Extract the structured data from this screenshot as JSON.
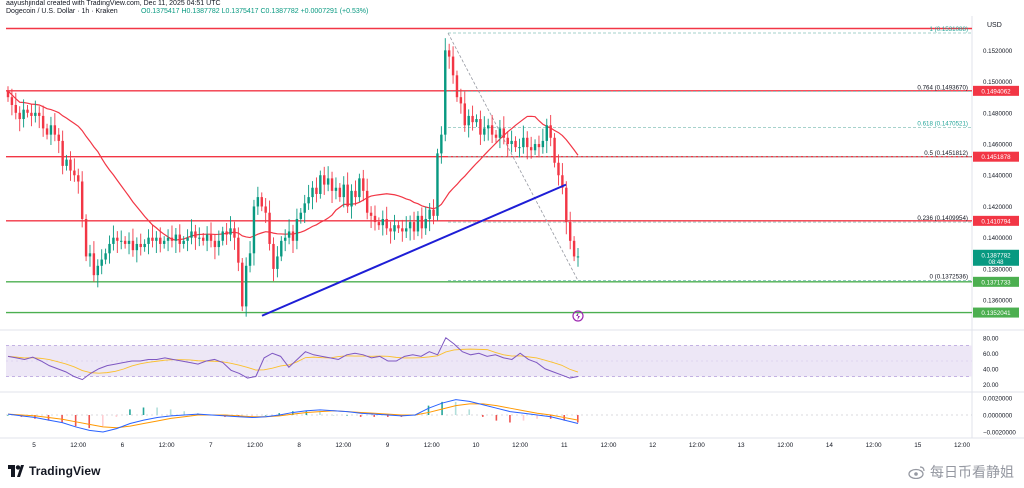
{
  "header": {
    "author_line": "aayushjindal created with TradingView.com, Dec 11, 2025 04:51 UTC",
    "symbol_line": "Dogecoin / U.S. Dollar · 1h · Kraken",
    "ohlc_line": "O0.1375417 H0.1387782 L0.1375417 C0.1387782 +0.0007291 (+0.53%)"
  },
  "footer": {
    "brand": "TradingView",
    "watermark": "每日币看静姐"
  },
  "colors": {
    "up": "#089981",
    "down": "#f23645",
    "ma": "#f23645",
    "trendline": "#1e1ed6",
    "hline_red": "#f23645",
    "hline_green": "#4caf50",
    "rsi": "#7e57c2",
    "rsi_band": "#ede7f6",
    "macd_line": "#2962ff",
    "signal_line": "#ff9800"
  },
  "chart_data": [
    {
      "type": "candlestick",
      "symbol": "Dogecoin / U.S. Dollar",
      "interval": "1h",
      "exchange": "Kraken",
      "axis_currency": "USD",
      "y_ticks": [
        "0.1520000",
        "0.1500000",
        "0.1480000",
        "0.1460000",
        "0.1440000",
        "0.1420000",
        "0.1400000",
        "0.1380000",
        "0.1360000"
      ],
      "x_ticks": [
        "5",
        "12:00",
        "6",
        "12:00",
        "7",
        "12:00",
        "8",
        "12:00",
        "9",
        "12:00",
        "10",
        "12:00",
        "11",
        "12:00",
        "12",
        "12:00",
        "13",
        "12:00",
        "14",
        "12:00",
        "15",
        "12:00"
      ],
      "ylim": [
        0.1346,
        0.1542
      ],
      "horizontal_levels": [
        {
          "price": 0.1494062,
          "label": "0.1494062",
          "color": "red"
        },
        {
          "price": 0.1451878,
          "label": "0.1451878",
          "color": "red"
        },
        {
          "price": 0.1410794,
          "label": "0.1410794",
          "color": "red"
        },
        {
          "price": 0.1371733,
          "label": "0.1371733",
          "color": "green"
        },
        {
          "price": 0.1352041,
          "label": "0.1352041",
          "color": "green"
        },
        {
          "price": 0.1534,
          "label": "",
          "color": "red"
        }
      ],
      "current_price": {
        "price": 0.1387782,
        "label": "0.1387782",
        "countdown": "08:48"
      },
      "fibonacci": [
        {
          "ratio": "1",
          "price": "0.1531088"
        },
        {
          "ratio": "0.764",
          "price": "0.1493670"
        },
        {
          "ratio": "0.618",
          "price": "0.1470521"
        },
        {
          "ratio": "0.5",
          "price": "0.1451812"
        },
        {
          "ratio": "0.236",
          "price": "0.1409954"
        },
        {
          "ratio": "0",
          "price": "0.1372536"
        }
      ],
      "trendline": {
        "from": 0.135,
        "to": 0.1434
      },
      "closes": [
        0.149,
        0.1485,
        0.148,
        0.1476,
        0.1482,
        0.148,
        0.1478,
        0.148,
        0.1478,
        0.147,
        0.1466,
        0.1472,
        0.1466,
        0.1462,
        0.1446,
        0.145,
        0.1443,
        0.144,
        0.1436,
        0.1412,
        0.1388,
        0.139,
        0.1376,
        0.1382,
        0.1386,
        0.139,
        0.1396,
        0.14,
        0.1398,
        0.1398,
        0.1396,
        0.1398,
        0.1392,
        0.1396,
        0.1394,
        0.1396,
        0.14,
        0.1398,
        0.14,
        0.1396,
        0.1398,
        0.14,
        0.1398,
        0.1402,
        0.1396,
        0.1398,
        0.14,
        0.1404,
        0.14,
        0.14,
        0.1398,
        0.1402,
        0.1398,
        0.1394,
        0.1398,
        0.1404,
        0.1402,
        0.1406,
        0.14,
        0.1384,
        0.1356,
        0.1382,
        0.139,
        0.142,
        0.1426,
        0.142,
        0.1416,
        0.1396,
        0.138,
        0.1388,
        0.1398,
        0.14,
        0.1404,
        0.1398,
        0.1412,
        0.1416,
        0.1422,
        0.1426,
        0.1432,
        0.1428,
        0.144,
        0.1434,
        0.1438,
        0.143,
        0.1432,
        0.1426,
        0.1434,
        0.142,
        0.143,
        0.1426,
        0.1438,
        0.143,
        0.1416,
        0.1414,
        0.141,
        0.1408,
        0.1412,
        0.1406,
        0.1404,
        0.1408,
        0.1406,
        0.1404,
        0.1406,
        0.141,
        0.1404,
        0.1414,
        0.1406,
        0.1412,
        0.1418,
        0.1414,
        0.1454,
        0.1466,
        0.152,
        0.1516,
        0.1504,
        0.149,
        0.1486,
        0.1472,
        0.1478,
        0.1474,
        0.1476,
        0.1466,
        0.147,
        0.1472,
        0.1466,
        0.1464,
        0.147,
        0.1464,
        0.146,
        0.1462,
        0.1458,
        0.1458,
        0.1464,
        0.1458,
        0.1456,
        0.146,
        0.1458,
        0.1462,
        0.1472,
        0.1464,
        0.1448,
        0.144,
        0.1432,
        0.141,
        0.1398,
        0.1388,
        0.1388
      ]
    },
    {
      "type": "line",
      "indicator": "RSI",
      "y_ticks": [
        "80.00",
        "60.00",
        "40.00",
        "20.00"
      ],
      "ylim": [
        10,
        90
      ],
      "band": [
        30,
        70
      ],
      "values": [
        56,
        54,
        52,
        55,
        50,
        44,
        40,
        36,
        30,
        26,
        34,
        40,
        44,
        46,
        48,
        50,
        50,
        52,
        52,
        54,
        52,
        50,
        48,
        46,
        50,
        52,
        48,
        38,
        34,
        28,
        30,
        54,
        60,
        56,
        42,
        52,
        62,
        58,
        56,
        54,
        52,
        58,
        60,
        58,
        54,
        56,
        50,
        50,
        56,
        58,
        56,
        62,
        58,
        80,
        72,
        62,
        58,
        60,
        56,
        58,
        54,
        52,
        60,
        52,
        48,
        40,
        36,
        32,
        28,
        30
      ]
    },
    {
      "type": "histogram+line",
      "indicator": "MACD",
      "y_ticks": [
        "0.0020000",
        "0.0000000",
        "−0.0020000"
      ],
      "ylim": [
        -0.0027,
        0.0027
      ],
      "macd": [
        0.0001,
        -0.0001,
        -0.0003,
        -0.0006,
        -0.0009,
        -0.0014,
        -0.0018,
        -0.002,
        -0.0016,
        -0.001,
        -0.0006,
        -0.0003,
        -0.0001,
        0.0,
        0.0001,
        0.0,
        -0.0001,
        -0.0002,
        -0.0003,
        -0.0002,
        0.0,
        0.0003,
        0.0005,
        0.0006,
        0.0005,
        0.0004,
        0.0002,
        0.0001,
        0.0,
        -0.0001,
        0.0,
        0.0008,
        0.0014,
        0.0018,
        0.0016,
        0.0012,
        0.0008,
        0.0004,
        0.0002,
        0.0,
        -0.0002,
        -0.0006,
        -0.001
      ],
      "signal": [
        0.0001,
        0.0,
        -0.0001,
        -0.0003,
        -0.0005,
        -0.0008,
        -0.0011,
        -0.0014,
        -0.0015,
        -0.0013,
        -0.001,
        -0.0007,
        -0.0004,
        -0.0002,
        0.0,
        0.0,
        0.0,
        -0.0001,
        -0.0002,
        -0.0002,
        -0.0001,
        0.0001,
        0.0003,
        0.0004,
        0.0005,
        0.0004,
        0.0003,
        0.0002,
        0.0001,
        0.0,
        0.0,
        0.0003,
        0.0007,
        0.0011,
        0.0013,
        0.0013,
        0.0011,
        0.0008,
        0.0005,
        0.0002,
        0.0,
        -0.0003,
        -0.0006
      ]
    }
  ]
}
